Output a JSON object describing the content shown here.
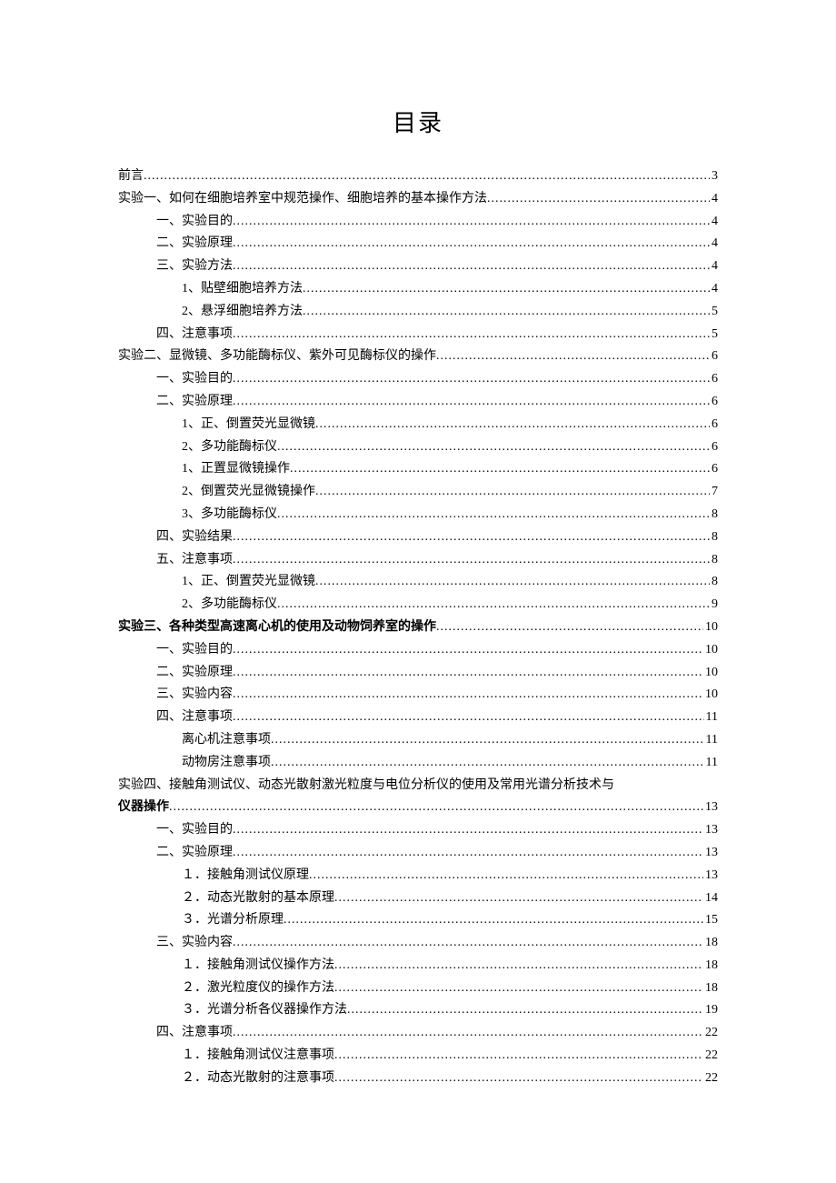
{
  "title": "目录",
  "entries": [
    {
      "label": "前言 ",
      "page": "3",
      "indent": 0,
      "bold": false
    },
    {
      "label": "实验一、如何在细胞培养室中规范操作、细胞培养的基本操作方法 ",
      "page": "4",
      "indent": 0,
      "bold": false
    },
    {
      "label": "一、实验目的 ",
      "page": "4",
      "indent": 1,
      "bold": false
    },
    {
      "label": "二、实验原理 ",
      "page": "4",
      "indent": 1,
      "bold": false
    },
    {
      "label": "三、实验方法 ",
      "page": "4",
      "indent": 1,
      "bold": false
    },
    {
      "label": "1、贴壁细胞培养方法 ",
      "page": "4",
      "indent": 2,
      "bold": false
    },
    {
      "label": "2、悬浮细胞培养方法 ",
      "page": "5",
      "indent": 2,
      "bold": false
    },
    {
      "label": "四、注意事项 ",
      "page": "5",
      "indent": 1,
      "bold": false
    },
    {
      "label": "实验二、显微镜、多功能酶标仪、紫外可见酶标仪的操作 ",
      "page": "6",
      "indent": 0,
      "bold": false
    },
    {
      "label": "一、实验目的 ",
      "page": "6",
      "indent": 1,
      "bold": false
    },
    {
      "label": "二、实验原理 ",
      "page": "6",
      "indent": 1,
      "bold": false
    },
    {
      "label": "1、正、倒置荧光显微镜 ",
      "page": "6",
      "indent": 2,
      "bold": false
    },
    {
      "label": "2、多功能酶标仪 ",
      "page": "6",
      "indent": 2,
      "bold": false
    },
    {
      "label": "1、正置显微镜操作 ",
      "page": "6",
      "indent": 2,
      "bold": false
    },
    {
      "label": "2、倒置荧光显微镜操作 ",
      "page": "7",
      "indent": 2,
      "bold": false
    },
    {
      "label": "3、多功能酶标仪 ",
      "page": "8",
      "indent": 2,
      "bold": false
    },
    {
      "label": "四、实验结果 ",
      "page": "8",
      "indent": 1,
      "bold": false
    },
    {
      "label": "五、注意事项 ",
      "page": "8",
      "indent": 1,
      "bold": false
    },
    {
      "label": "1、正、倒置荧光显微镜 ",
      "page": "8",
      "indent": 2,
      "bold": false
    },
    {
      "label": "2、多功能酶标仪 ",
      "page": "9",
      "indent": 2,
      "bold": false
    },
    {
      "label": "实验三、各种类型高速离心机的使用及动物饲养室的操作 ",
      "page": "10",
      "indent": 0,
      "bold": true
    },
    {
      "label": "一、实验目的 ",
      "page": "10",
      "indent": 1,
      "bold": false
    },
    {
      "label": "二、实验原理 ",
      "page": "10",
      "indent": 1,
      "bold": false
    },
    {
      "label": "三、实验内容 ",
      "page": "10",
      "indent": 1,
      "bold": false
    },
    {
      "label": "四、注意事项 ",
      "page": "11",
      "indent": 1,
      "bold": false
    },
    {
      "label": "离心机注意事项 ",
      "page": "11",
      "indent": 2,
      "bold": false
    },
    {
      "label": "动物房注意事项 ",
      "page": "11",
      "indent": 2,
      "bold": false
    },
    {
      "label": "实验四、接触角测试仪、动态光散射激光粒度与电位分析仪的使用及常用光谱分析技术与",
      "page": "",
      "indent": 0,
      "bold": false,
      "nowrap": true
    },
    {
      "label": "仪器操作 ",
      "page": "13",
      "indent": 0,
      "bold": true
    },
    {
      "label": "一、实验目的 ",
      "page": "13",
      "indent": 1,
      "bold": false
    },
    {
      "label": "二、实验原理 ",
      "page": "13",
      "indent": 1,
      "bold": false
    },
    {
      "label": "１．接触角测试仪原理 ",
      "page": "13",
      "indent": 2,
      "bold": false
    },
    {
      "label": "２．动态光散射的基本原理 ",
      "page": "14",
      "indent": 2,
      "bold": false
    },
    {
      "label": "３．光谱分析原理",
      "page": "15",
      "indent": 2,
      "bold": false
    },
    {
      "label": "三、实验内容 ",
      "page": "18",
      "indent": 1,
      "bold": false
    },
    {
      "label": "１．接触角测试仪操作方法",
      "page": "18",
      "indent": 2,
      "bold": false
    },
    {
      "label": "２．激光粒度仪的操作方法 ",
      "page": "18",
      "indent": 2,
      "bold": false
    },
    {
      "label": "３．光谱分析各仪器操作方法 ",
      "page": "19",
      "indent": 2,
      "bold": false
    },
    {
      "label": "四、注意事项 ",
      "page": "22",
      "indent": 1,
      "bold": false
    },
    {
      "label": "１．接触角测试仪注意事项 ",
      "page": "22",
      "indent": 2,
      "bold": false
    },
    {
      "label": "２．动态光散射的注意事项",
      "page": "22",
      "indent": 2,
      "bold": false
    }
  ]
}
